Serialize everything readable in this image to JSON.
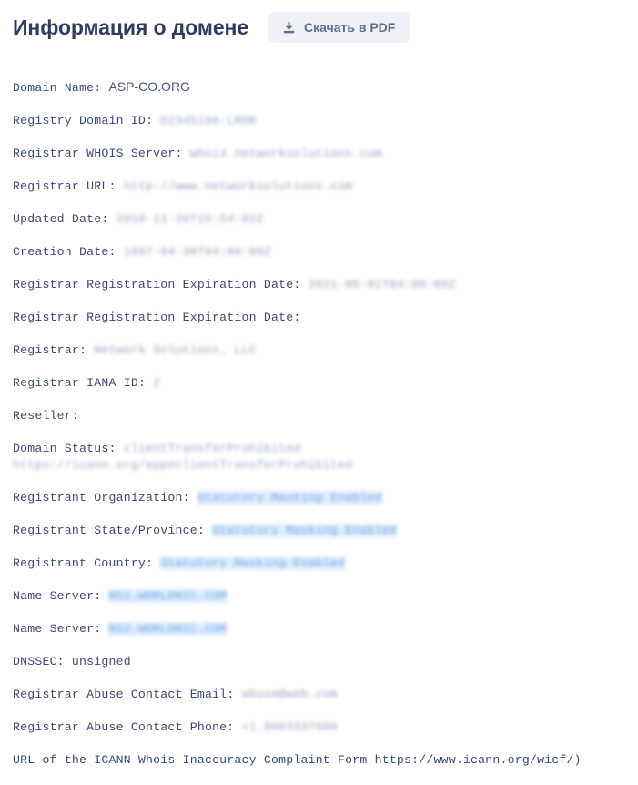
{
  "header": {
    "title": "Информация о домене",
    "download_button": {
      "label": "Скачать в PDF",
      "icon": "download-icon"
    }
  },
  "colors": {
    "title": "#2f3b63",
    "button_bg": "#eff1f6",
    "button_text": "#5d6d90",
    "mono_text": "#3b4a72",
    "link_highlight_bg": "#dcebfb",
    "link_text": "#5b9ae6",
    "page_bg": "#ffffff"
  },
  "whois": {
    "lines": [
      {
        "label": "Domain Name: ",
        "value": "ASP-CO.ORG",
        "style": "plain"
      },
      {
        "label": "Registry Domain ID: ",
        "value": "D2345166-LROR",
        "style": "blur"
      },
      {
        "label": "Registrar WHOIS Server: ",
        "value": "whois.networksolutions.com",
        "style": "blur"
      },
      {
        "label": "Registrar URL: ",
        "value": "http://www.networksolutions.com",
        "style": "blur"
      },
      {
        "label": "Updated Date: ",
        "value": "2018-11-20T15:54:02Z",
        "style": "blur"
      },
      {
        "label": "Creation Date: ",
        "value": "1997-04-30T04:00:00Z",
        "style": "blur"
      },
      {
        "label": "Registrar Registration Expiration Date: ",
        "value": "2021-05-01T04:00:00Z",
        "style": "blur"
      },
      {
        "label": "Registrar Registration Expiration Date: ",
        "value": "",
        "style": "none"
      },
      {
        "label": "Registrar: ",
        "value": "Network Solutions, LLC",
        "style": "blur"
      },
      {
        "label": "Registrar IANA ID: ",
        "value": "2",
        "style": "blur"
      },
      {
        "label": "Reseller: ",
        "value": "",
        "style": "none"
      },
      {
        "label": "Domain Status: ",
        "value": "clientTransferProhibited https://icann.org/epp#clientTransferProhibited",
        "style": "blur"
      },
      {
        "label": "Registrant Organization: ",
        "value": "Statutory Masking Enabled",
        "style": "link"
      },
      {
        "label": "Registrant State/Province: ",
        "value": "Statutory Masking Enabled",
        "style": "link"
      },
      {
        "label": "Registrant Country: ",
        "value": "Statutory Masking Enabled",
        "style": "link"
      },
      {
        "label": "Name Server: ",
        "value": "NS1.WORLDNIC.COM",
        "style": "link"
      },
      {
        "label": "Name Server: ",
        "value": "NS2.WORLDNIC.COM",
        "style": "link"
      },
      {
        "label": "DNSSEC: unsigned",
        "value": "",
        "style": "none"
      },
      {
        "label": "Registrar Abuse Contact Email: ",
        "value": "abuse@web.com",
        "style": "blur"
      },
      {
        "label": "Registrar Abuse Contact Phone: ",
        "value": "+1.8003337680",
        "style": "blur"
      },
      {
        "label": "URL of the ICANN Whois Inaccuracy Complaint Form https://www.icann.org/wicf/)",
        "value": "",
        "style": "none"
      }
    ]
  }
}
